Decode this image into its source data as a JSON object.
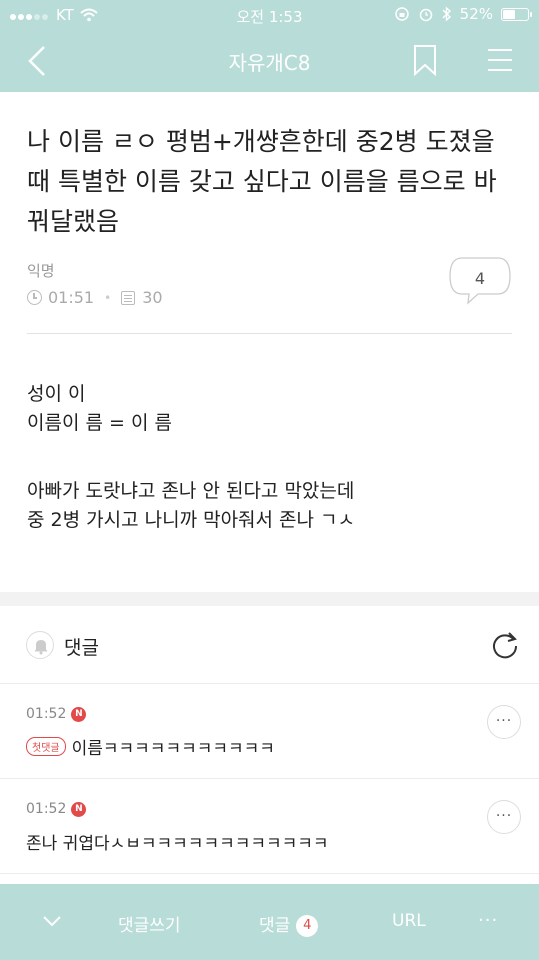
{
  "status_bar": {
    "carrier": "KT",
    "time": "오전 1:53",
    "battery": "52%",
    "battery_level": 0.52
  },
  "header": {
    "title": "자유개C8"
  },
  "post": {
    "title": "나 이름 ㄹㅇ 평범+개썅흔한데 중2병 도졌을 때 특별한 이름 갖고 싶다고 이름을 름으로 바꿔달랬음",
    "author": "익명",
    "time": "01:51",
    "views": "30",
    "comment_count": "4",
    "body": [
      "성이 이",
      "이름이 름 = 이 름",
      "",
      "아빠가 도랏냐고 존나 안 된다고 막았는데",
      "중 2병 가시고 나니까 막아줘서 존나 ㄱㅅ"
    ]
  },
  "comments": {
    "header_label": "댓글",
    "items": [
      {
        "time": "01:52",
        "new_badge": "N",
        "first_badge": "첫댓글",
        "text": "이름ㅋㅋㅋㅋㅋㅋㅋㅋㅋㅋㅋ"
      },
      {
        "time": "01:52",
        "new_badge": "N",
        "text": "존나 귀엽다ㅅㅂㅋㅋㅋㅋㅋㅋㅋㅋㅋㅋㅋㅋ"
      }
    ]
  },
  "bottom_bar": {
    "write_label": "댓글쓰기",
    "comments_label": "댓글",
    "comments_count": "4",
    "url_label": "URL",
    "more_label": "···"
  },
  "colors": {
    "teal": "#b8dcd8",
    "badge_red": "#e24a4a"
  }
}
